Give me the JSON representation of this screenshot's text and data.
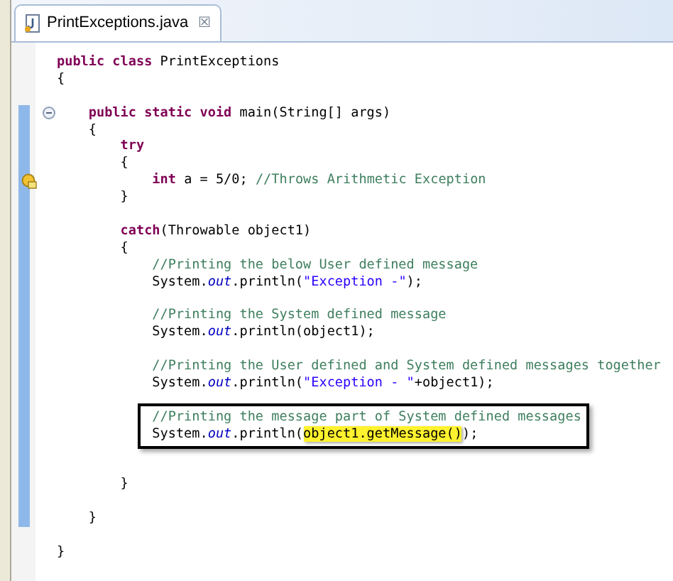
{
  "tab": {
    "title": "PrintExceptions.java",
    "close": "☒",
    "selected": true
  },
  "blocks": [
    {
      "highlighted": false,
      "lines": [
        {
          "kind": "code",
          "tokens": [
            {
              "kind": "keyword",
              "text": "public class"
            },
            {
              "kind": "plain",
              "text": " PrintExceptions"
            }
          ]
        },
        {
          "kind": "code",
          "tokens": [
            {
              "kind": "plain",
              "text": "{"
            }
          ]
        },
        {
          "kind": "blank"
        }
      ]
    },
    {
      "highlighted": true,
      "lines": [
        {
          "kind": "fold",
          "tokens": [
            {
              "kind": "keyword",
              "text": "    public static void"
            },
            {
              "kind": "plain",
              "text": " main(String[] args)"
            }
          ]
        },
        {
          "kind": "code",
          "tokens": [
            {
              "kind": "plain",
              "text": "    {"
            }
          ]
        },
        {
          "kind": "code",
          "tokens": [
            {
              "kind": "keyword",
              "text": "        try"
            }
          ]
        },
        {
          "kind": "code",
          "tokens": [
            {
              "kind": "plain",
              "text": "        {"
            }
          ]
        },
        {
          "kind": "warning",
          "tokens": [
            {
              "kind": "keyword",
              "text": "            int"
            },
            {
              "kind": "plain",
              "text": " a = 5/0; "
            },
            {
              "kind": "comment",
              "text": "//Throws Arithmetic Exception"
            }
          ]
        },
        {
          "kind": "code",
          "tokens": [
            {
              "kind": "plain",
              "text": "        }"
            }
          ]
        },
        {
          "kind": "blank"
        },
        {
          "kind": "code",
          "tokens": [
            {
              "kind": "keyword",
              "text": "        catch"
            },
            {
              "kind": "plain",
              "text": "(Throwable object1)"
            }
          ]
        },
        {
          "kind": "code",
          "tokens": [
            {
              "kind": "plain",
              "text": "        {"
            }
          ]
        },
        {
          "kind": "code",
          "tokens": [
            {
              "kind": "comment",
              "text": "            //Printing the below User defined message"
            }
          ]
        },
        {
          "kind": "code",
          "tokens": [
            {
              "kind": "plain",
              "text": "            System."
            },
            {
              "kind": "field",
              "text": "out"
            },
            {
              "kind": "plain",
              "text": ".println("
            },
            {
              "kind": "string",
              "text": "\"Exception -\""
            },
            {
              "kind": "plain",
              "text": ");"
            }
          ]
        },
        {
          "kind": "blank"
        },
        {
          "kind": "code",
          "tokens": [
            {
              "kind": "comment",
              "text": "            //Printing the System defined message"
            }
          ]
        },
        {
          "kind": "code",
          "tokens": [
            {
              "kind": "plain",
              "text": "            System."
            },
            {
              "kind": "field",
              "text": "out"
            },
            {
              "kind": "plain",
              "text": ".println(object1);"
            }
          ]
        },
        {
          "kind": "blank"
        },
        {
          "kind": "code",
          "tokens": [
            {
              "kind": "comment",
              "text": "            //Printing the User defined and System defined messages together"
            }
          ]
        },
        {
          "kind": "code",
          "tokens": [
            {
              "kind": "plain",
              "text": "            System."
            },
            {
              "kind": "field",
              "text": "out"
            },
            {
              "kind": "plain",
              "text": ".println("
            },
            {
              "kind": "string",
              "text": "\"Exception - \""
            },
            {
              "kind": "plain",
              "text": "+object1);"
            }
          ]
        },
        {
          "kind": "blank"
        },
        {
          "kind": "code",
          "boxed": true,
          "tokens": [
            {
              "kind": "comment",
              "text": "            //Printing the message part of System defined messages"
            }
          ]
        },
        {
          "kind": "code",
          "boxed": true,
          "tokens": [
            {
              "kind": "plain",
              "text": "            System."
            },
            {
              "kind": "field",
              "text": "out"
            },
            {
              "kind": "plain",
              "text": ".println("
            },
            {
              "kind": "highlight",
              "text": "object1.getMessage()"
            },
            {
              "kind": "plain",
              "text": ");"
            }
          ]
        },
        {
          "kind": "blank"
        },
        {
          "kind": "blank"
        },
        {
          "kind": "code",
          "tokens": [
            {
              "kind": "plain",
              "text": "        }"
            }
          ]
        },
        {
          "kind": "blank"
        },
        {
          "kind": "code",
          "tokens": [
            {
              "kind": "plain",
              "text": "    }"
            }
          ]
        }
      ]
    },
    {
      "highlighted": false,
      "lines": [
        {
          "kind": "blank"
        },
        {
          "kind": "code",
          "tokens": [
            {
              "kind": "plain",
              "text": "}"
            }
          ]
        }
      ]
    }
  ]
}
